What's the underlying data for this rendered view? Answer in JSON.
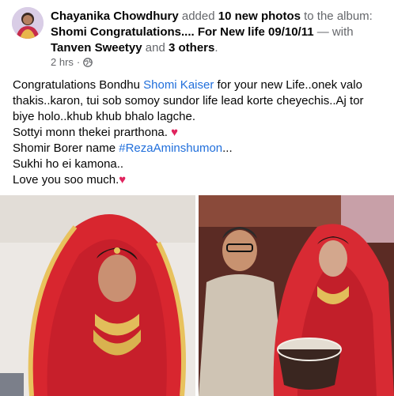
{
  "post": {
    "author": "Chayanika Chowdhury",
    "action_prefix": "added",
    "photo_count": "10 new photos",
    "action_mid": "to the album:",
    "album": "Shomi Congratulations.... For New life 09/10/11",
    "with_prefix": "— with",
    "tagged_person": "Tanven Sweetyy",
    "and": "and",
    "others": "3 others",
    "period": ".",
    "time": "2 hrs",
    "dot": "·"
  },
  "body": {
    "line1_a": "Congratulations Bondhu",
    "line1_link": "Shomi Kaiser",
    "line1_b": "for your new Life..onek valo thakis..karon, tui sob somoy sundor life lead korte cheyechis..Aj tor biye holo..khub khub bhalo lagche.",
    "line2": "Sottyi monn thekei prarthona.",
    "line3_a": "Shomir Borer name",
    "line3_hashtag": "#RezaAminshumon",
    "line3_b": "...",
    "line4": "Sukhi ho ei kamona..",
    "line5": "Love you soo much.",
    "heart": "♥"
  },
  "colors": {
    "link": "#216fdb",
    "meta": "#65676b",
    "text": "#050505",
    "heart": "#e0245e"
  },
  "icons": {
    "globe": "globe-icon",
    "avatar": "avatar"
  }
}
